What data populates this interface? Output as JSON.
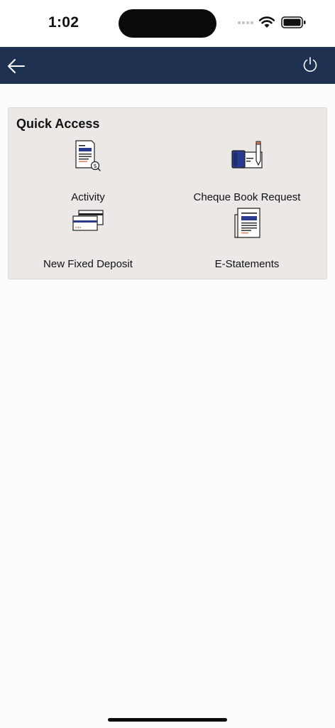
{
  "status_bar": {
    "time": "1:02",
    "icons": [
      "signal-icon",
      "wifi-icon",
      "battery-icon"
    ]
  },
  "header": {
    "back_icon": "arrow-left-icon",
    "power_icon": "power-icon",
    "bg_color": "#1e3150"
  },
  "quick_access": {
    "title": "Quick Access",
    "tiles": [
      {
        "label": "Activity",
        "icon": "activity-icon"
      },
      {
        "label": "Cheque Book Request",
        "icon": "cheque-book-icon"
      },
      {
        "label": "New Fixed Deposit",
        "icon": "fixed-deposit-icon"
      },
      {
        "label": "E-Statements",
        "icon": "e-statements-icon"
      }
    ]
  },
  "colors": {
    "accent_navy": "#2a3b8f",
    "accent_orange": "#e07a4f",
    "card_bg": "#ebe8e6"
  }
}
